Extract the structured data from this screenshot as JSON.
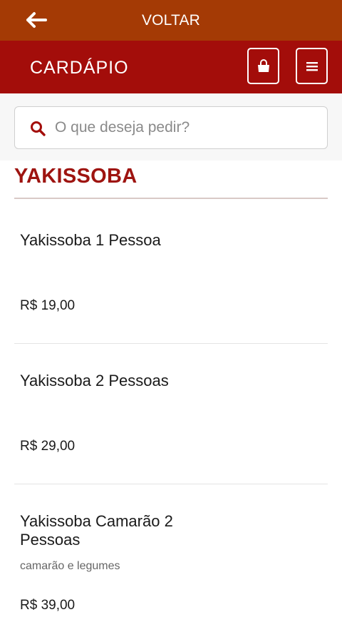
{
  "topbar": {
    "back_icon": "arrow-left-icon",
    "title": "VOLTAR"
  },
  "header": {
    "brand": "CARDÁPIO",
    "cart_icon": "shopping-bag-icon",
    "menu_icon": "hamburger-menu-icon"
  },
  "search": {
    "icon": "search-icon",
    "placeholder": "O que deseja pedir?",
    "value": ""
  },
  "category": {
    "title": "YAKISSOBA"
  },
  "items": [
    {
      "name": "Yakissoba 1 Pessoa",
      "description": "",
      "price": "R$ 19,00"
    },
    {
      "name": "Yakissoba 2 Pessoas",
      "description": "",
      "price": "R$ 29,00"
    },
    {
      "name": "Yakissoba Camarão 2 Pessoas",
      "description": "camarão e legumes",
      "price": "R$ 39,00"
    }
  ],
  "colors": {
    "topbar": "#a43a05",
    "header": "#a30d0a",
    "category_title": "#9e1410",
    "search_icon": "#a30d0a"
  }
}
